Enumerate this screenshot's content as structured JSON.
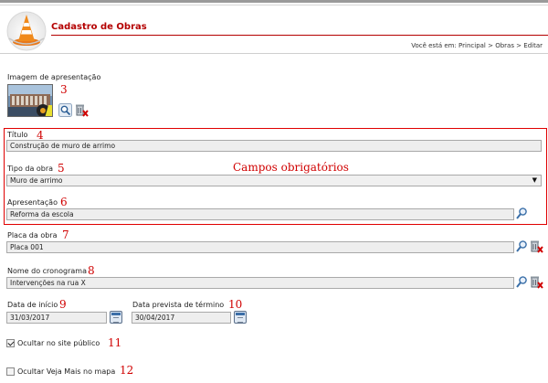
{
  "header": {
    "title": "Cadastro de Obras",
    "breadcrumb": "Você está em: Principal > Obras > Editar"
  },
  "image_section": {
    "label": "Imagem de apresentação",
    "number": "3"
  },
  "required_note": "Campos obrigatórios",
  "fields": {
    "titulo": {
      "label": "Título",
      "number": "4",
      "value": "Construção de muro de arrimo"
    },
    "tipo": {
      "label": "Tipo da obra",
      "number": "5",
      "value": "Muro de arrimo"
    },
    "apresentacao": {
      "label": "Apresentação",
      "number": "6",
      "value": "Reforma da escola"
    },
    "placa": {
      "label": "Placa da obra",
      "number": "7",
      "value": "Placa 001"
    },
    "cronograma": {
      "label": "Nome do cronograma",
      "number": "8",
      "value": "Intervenções na rua X"
    },
    "data_inicio": {
      "label": "Data de início",
      "number": "9",
      "value": "31/03/2017"
    },
    "data_termino": {
      "label": "Data prevista de término",
      "number": "10",
      "value": "30/04/2017"
    }
  },
  "options": {
    "ocultar_site": {
      "label": "Ocultar no site público",
      "number": "11",
      "checked": true
    },
    "ocultar_mapa": {
      "label": "Ocultar Veja Mais no mapa",
      "number": "12",
      "checked": false
    }
  },
  "icons": [
    "traffic-cone-logo-icon",
    "search-icon",
    "delete-icon",
    "calendar-icon",
    "dropdown-arrow-icon",
    "checkbox-icon"
  ],
  "colors": {
    "accent": "#b40000",
    "annotation": "#d00000",
    "field_bg": "#eeeeee"
  }
}
